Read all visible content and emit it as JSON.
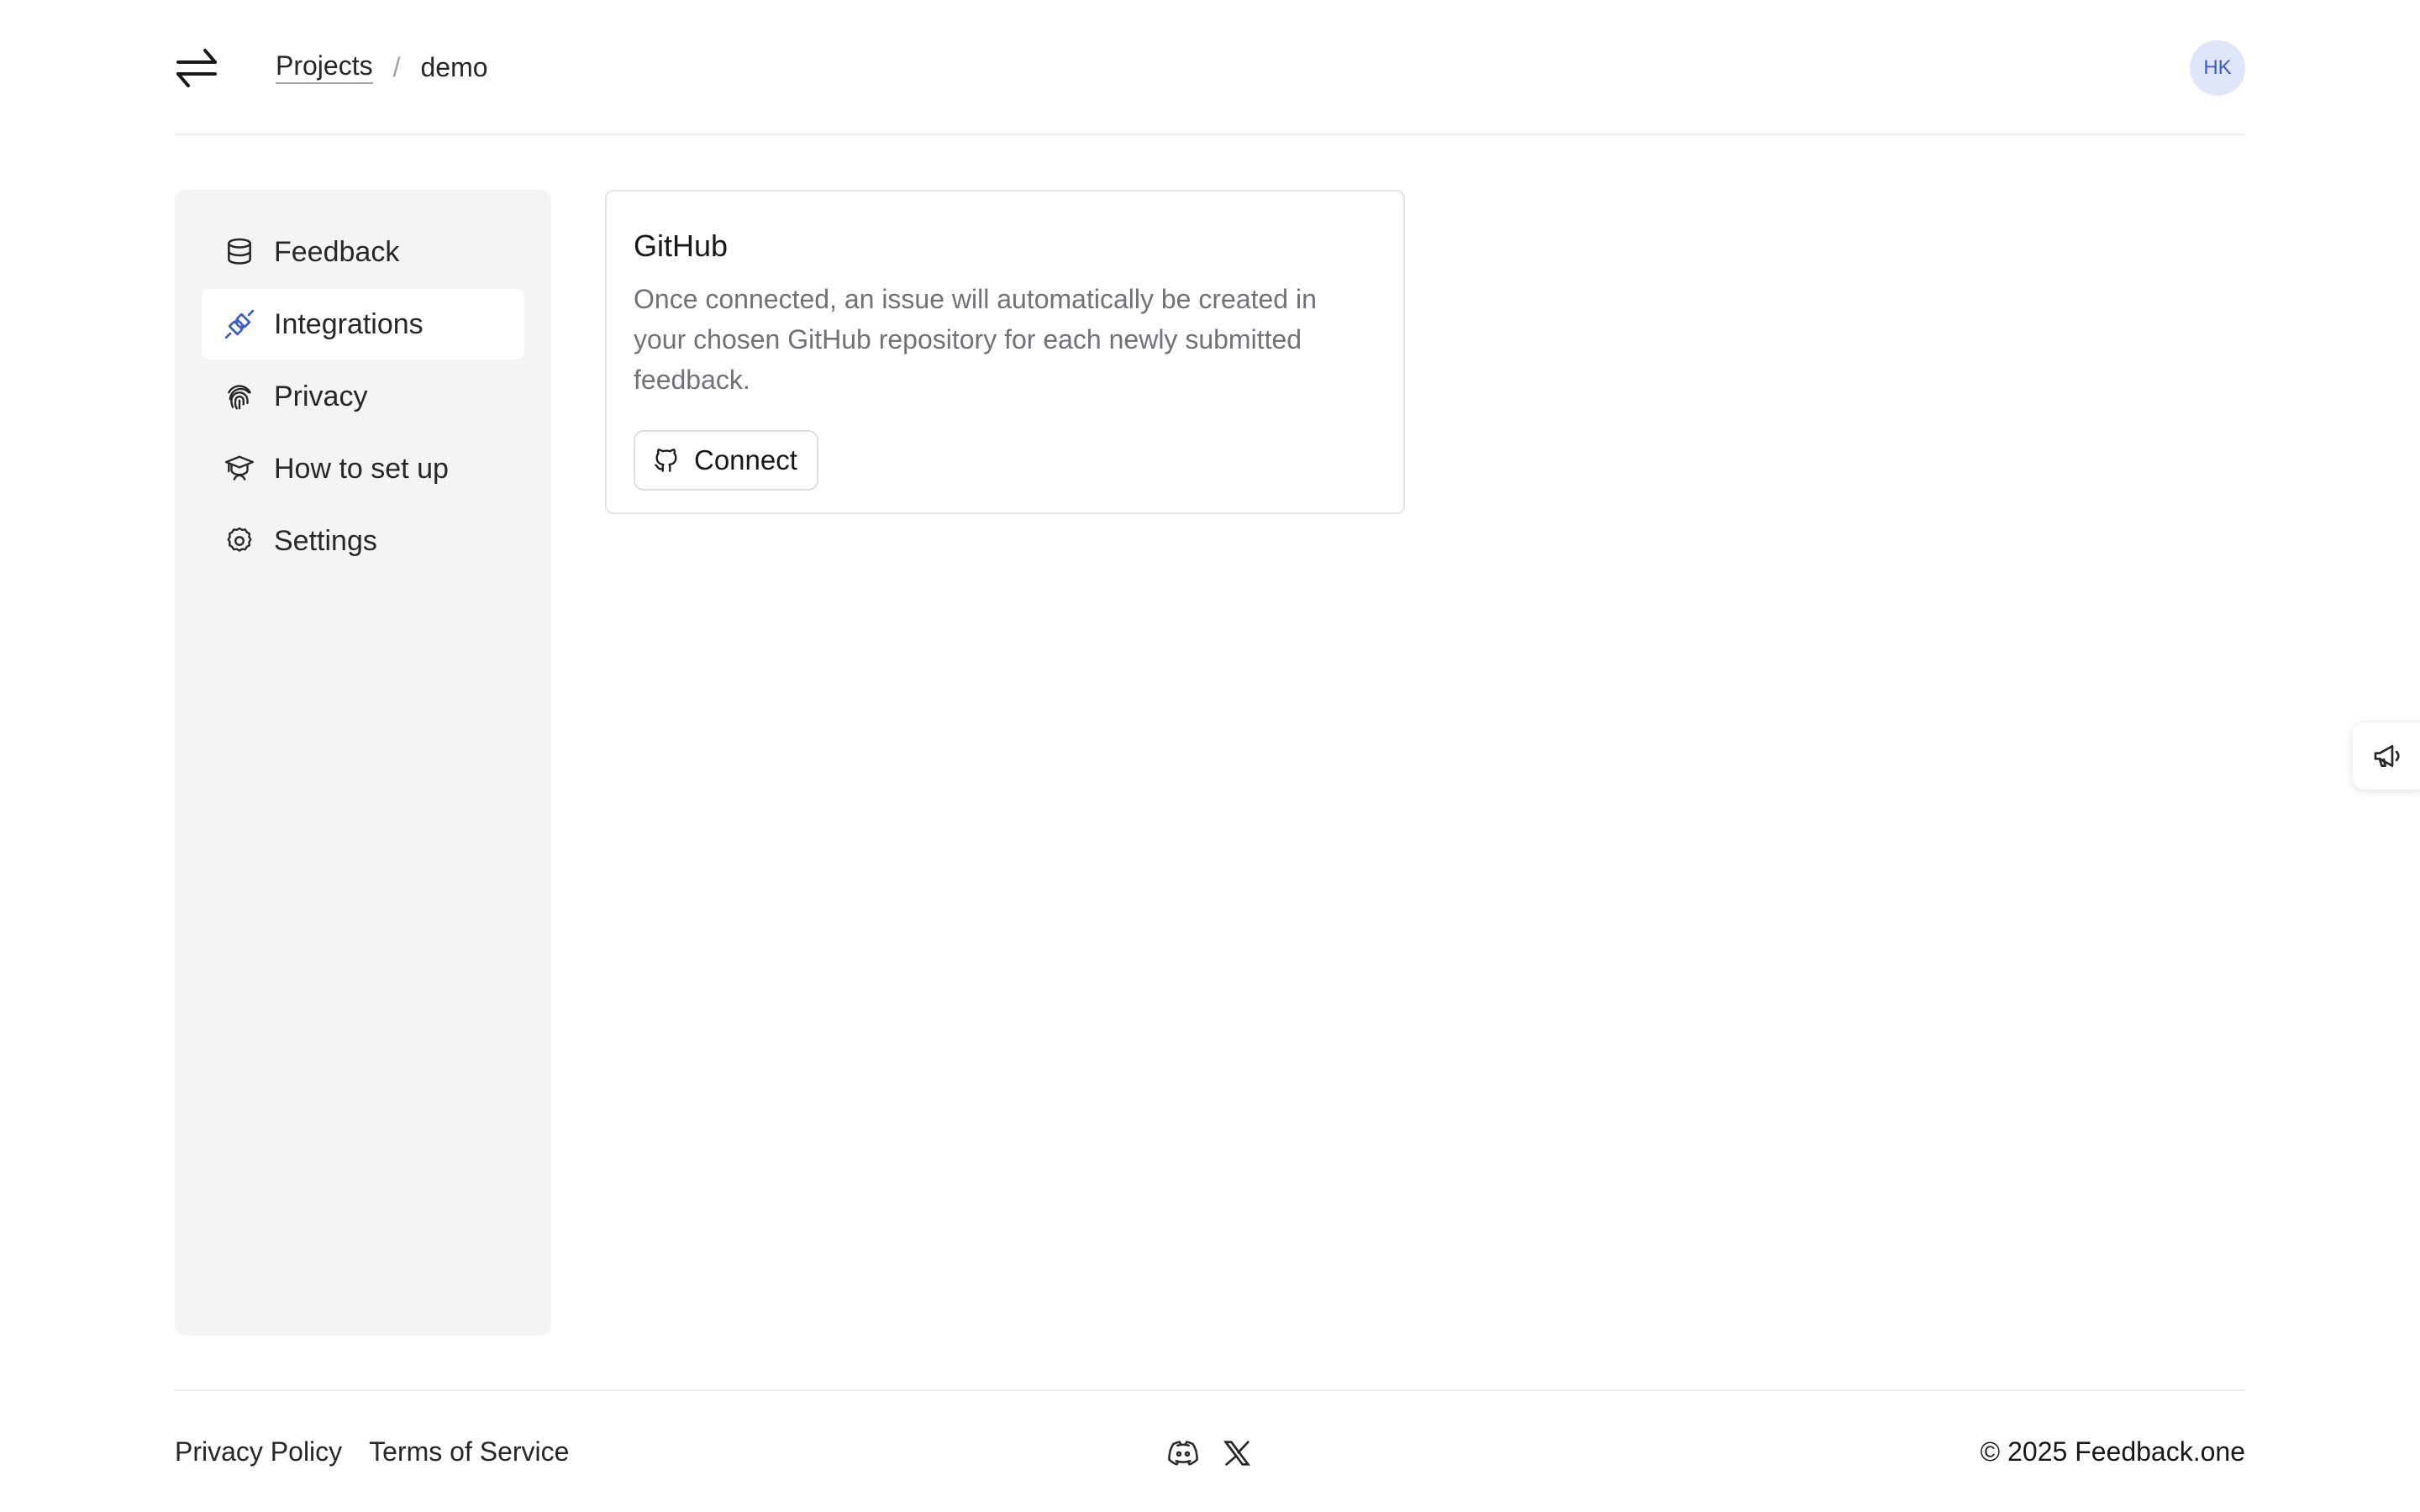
{
  "header": {
    "logo_icon": "arrows-exchange-icon",
    "breadcrumb": {
      "projects": "Projects",
      "separator": "/",
      "current": "demo"
    },
    "avatar_initials": "HK"
  },
  "sidebar": {
    "items": [
      {
        "label": "Feedback",
        "icon": "database-icon",
        "active": false
      },
      {
        "label": "Integrations",
        "icon": "plug-icon",
        "active": true
      },
      {
        "label": "Privacy",
        "icon": "fingerprint-icon",
        "active": false
      },
      {
        "label": "How to set up",
        "icon": "graduation-cap-icon",
        "active": false
      },
      {
        "label": "Settings",
        "icon": "gear-icon",
        "active": false
      }
    ]
  },
  "integration_card": {
    "title": "GitHub",
    "description": "Once connected, an issue will automatically be created in your chosen GitHub repository for each newly submitted feedback.",
    "button_label": "Connect",
    "button_icon": "github-icon"
  },
  "floating_tab": {
    "icon": "megaphone-icon"
  },
  "footer": {
    "privacy_policy": "Privacy Policy",
    "terms_of_service": "Terms of Service",
    "social_icons": [
      "discord-icon",
      "x-icon"
    ],
    "copyright": "© 2025 Feedback.one"
  },
  "colors": {
    "accent": "#3b5bcc",
    "avatar_bg": "#dfe6fa",
    "sidebar_bg": "#f4f4f5",
    "muted_text": "#71717a"
  }
}
